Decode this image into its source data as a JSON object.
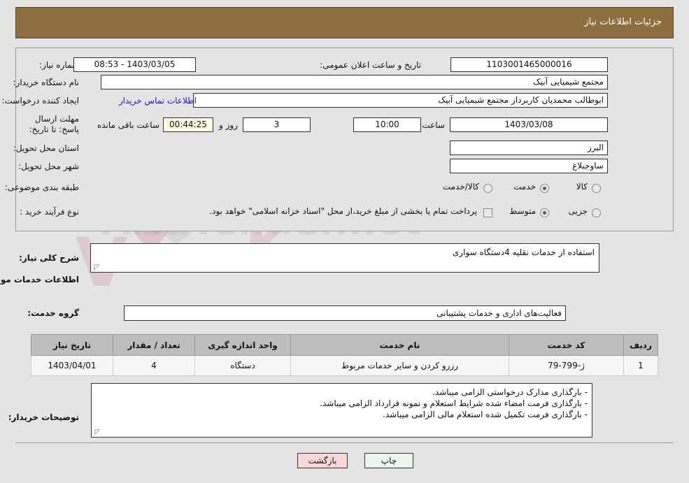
{
  "header": {
    "title": "جزئیات اطلاعات نیاز"
  },
  "form": {
    "need_number_label": "شماره نیاز:",
    "need_number_value": "1103001465000016",
    "announce_label": "تاریخ و ساعت اعلان عمومی:",
    "announce_value": "1403/03/05 - 08:53",
    "buyer_org_label": "نام دستگاه خریدار:",
    "buyer_org_value": "مجتمع شیمیایی آبیک",
    "creator_label": "ایجاد کننده درخواست:",
    "creator_value": "ابوطالب محمدیان کاربرداز مجتمع شیمیایی آبیک",
    "contact_link": "اطلاعات تماس خریدار",
    "deadline_label": "مهلت ارسال پاسخ: تا تاریخ:",
    "deadline_date": "1403/03/08",
    "hour_label": "ساعت",
    "deadline_time": "10:00",
    "days_value": "3",
    "days_label": "روز و",
    "countdown_value": "00:44:25",
    "countdown_label": "ساعت باقی مانده",
    "province_label": "استان محل تحویل:",
    "province_value": "البرز",
    "city_label": "شهر محل تحویل:",
    "city_value": "ساوجبلاغ",
    "category_label": "طبقه بندی موضوعی:",
    "category_options": [
      "کالا",
      "خدمت",
      "کالا/خدمت"
    ],
    "category_selected": "خدمت",
    "process_label": "نوع فرآیند خرید :",
    "process_options": [
      "جزیی",
      "متوسط"
    ],
    "process_selected": "متوسط",
    "treasury_note": "پرداخت تمام یا بخشی از مبلغ خرید،از محل \"اسناد خزانه اسلامی\" خواهد بود.",
    "treasury_checked": false
  },
  "description": {
    "summary_label": "شرح کلی نیاز:",
    "summary_value": "استفاده از خدمات نقلیه 4دستگاه سواری",
    "services_heading": "اطلاعات خدمات مورد نیاز",
    "service_group_label": "گروه خدمت:",
    "service_group_value": "فعالیت‌های اداری و خدمات پشتیبانی"
  },
  "table": {
    "columns": [
      "ردیف",
      "کد خدمت",
      "نام خدمت",
      "واحد اندازه گیری",
      "تعداد / مقدار",
      "تاریخ نیاز"
    ],
    "rows": [
      {
        "row": "1",
        "code": "ژ-799-79",
        "name": "رزرو کردن و سایر خدمات مربوط",
        "unit": "دستگاه",
        "quantity": "4",
        "date": "1403/04/01"
      }
    ]
  },
  "notes": {
    "label": "توضیحات خریدار:",
    "lines": [
      "- بارگذاری مدارک درخواستی الزامی میباشد.",
      "- بارگذاری فرمت امضاء شده شرایط استعلام و نمونه قرارداد الزامی میباشد.",
      "- بارگذاری فرمت تکمیل شده استعلام مالی الزامی میباشد."
    ]
  },
  "footer": {
    "print_label": "چاپ",
    "back_label": "بازگشت"
  },
  "watermark": {
    "text": "AriaTender.net"
  },
  "colors": {
    "header_brown": "#8c6e41",
    "page_bg": "#e4e4e4",
    "link_blue": "#1414d6",
    "countdown_bg": "#fbfbe4",
    "print_bg": "#eaf7ea",
    "back_bg": "#fcd7d7"
  }
}
